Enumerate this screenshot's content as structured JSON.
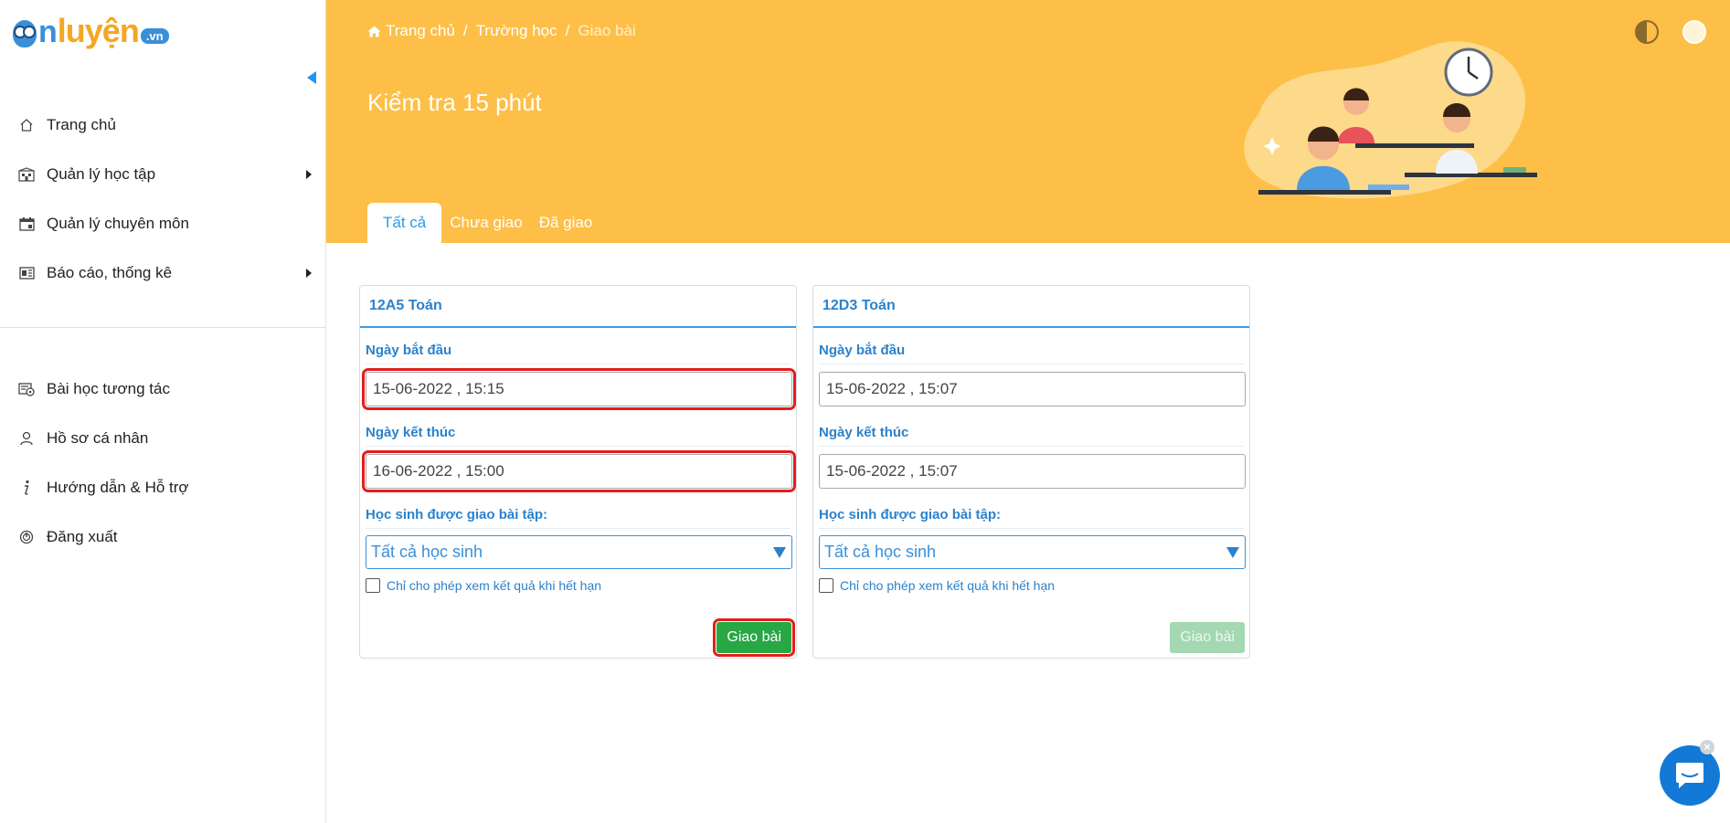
{
  "logo": {
    "text_n": "n",
    "text_luyen": "luyện",
    "text_vn": ".vn"
  },
  "sidebar": {
    "top_items": [
      {
        "label": "Trang chủ",
        "icon": "home-icon",
        "has_submenu": false
      },
      {
        "label": "Quản lý học tập",
        "icon": "building-icon",
        "has_submenu": true
      },
      {
        "label": "Quản lý chuyên môn",
        "icon": "calendar-icon",
        "has_submenu": false
      },
      {
        "label": "Báo cáo, thống kê",
        "icon": "report-icon",
        "has_submenu": true
      }
    ],
    "bottom_items": [
      {
        "label": "Bài học tương tác",
        "icon": "interactive-lesson-icon"
      },
      {
        "label": "Hồ sơ cá nhân",
        "icon": "user-icon"
      },
      {
        "label": "Hướng dẫn & Hỗ trợ",
        "icon": "info-icon"
      },
      {
        "label": "Đăng xuất",
        "icon": "power-icon"
      }
    ]
  },
  "header": {
    "breadcrumb": {
      "home": "Trang chủ",
      "school": "Trường học",
      "current": "Giao bài"
    },
    "title": "Kiểm tra 15 phút",
    "tabs": [
      {
        "label": "Tất cả",
        "active": true
      },
      {
        "label": "Chưa giao",
        "active": false
      },
      {
        "label": "Đã giao",
        "active": false
      }
    ],
    "background_color": "#fdbf47"
  },
  "cards": [
    {
      "class_name": "12A5 Toán",
      "start_label": "Ngày bắt đầu",
      "start_value": "15-06-2022 , 15:15",
      "end_label": "Ngày kết thúc",
      "end_value": "16-06-2022 , 15:00",
      "students_label": "Học sinh được giao bài tập:",
      "students_value": "Tất cả học sinh",
      "checkbox_label": "Chỉ cho phép xem kết quả khi hết hạn",
      "button_label": "Giao bài",
      "button_enabled": true,
      "highlighted": true
    },
    {
      "class_name": "12D3 Toán",
      "start_label": "Ngày bắt đầu",
      "start_value": "15-06-2022 , 15:07",
      "end_label": "Ngày kết thúc",
      "end_value": "15-06-2022 , 15:07",
      "students_label": "Học sinh được giao bài tập:",
      "students_value": "Tất cả học sinh",
      "checkbox_label": "Chỉ cho phép xem kết quả khi hết hạn",
      "button_label": "Giao bài",
      "button_enabled": false,
      "highlighted": false
    }
  ],
  "colors": {
    "accent": "#2b82cc",
    "success": "#28a745",
    "highlight": "#e51c1c",
    "chat": "#1479d6"
  }
}
